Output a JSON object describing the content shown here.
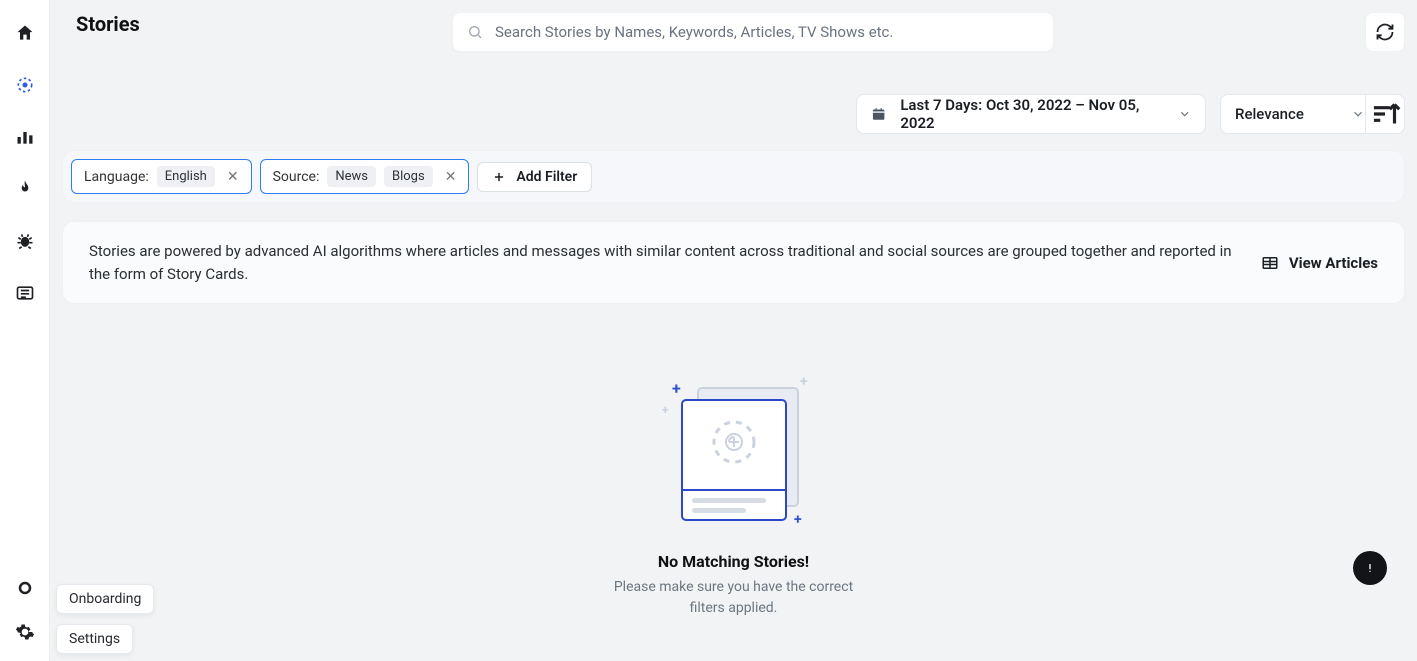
{
  "header": {
    "title": "Stories",
    "search_placeholder": "Search Stories by Names, Keywords, Articles, TV Shows etc."
  },
  "controls": {
    "date_label": "Last 7 Days: Oct 30, 2022 – Nov 05, 2022",
    "sort_label": "Relevance"
  },
  "filters": {
    "chips": [
      {
        "label": "Language:",
        "tags": [
          "English"
        ]
      },
      {
        "label": "Source:",
        "tags": [
          "News",
          "Blogs"
        ]
      }
    ],
    "add_label": "Add Filter"
  },
  "info": {
    "description": "Stories are powered by advanced AI algorithms where articles and messages with similar content across traditional and social sources are grouped together and reported in the form of Story Cards.",
    "view_articles_label": "View Articles"
  },
  "empty": {
    "title": "No Matching Stories!",
    "subtitle_line1": "Please make sure you have the correct",
    "subtitle_line2": "filters applied."
  },
  "sidebar": {
    "tooltips": {
      "onboarding": "Onboarding",
      "settings": "Settings"
    }
  },
  "icons": {
    "home": "home-icon",
    "target": "target-icon",
    "analytics": "analytics-icon",
    "trending": "trending-icon",
    "bug": "bug-icon",
    "news": "news-icon",
    "onboarding": "onboarding-icon",
    "settings": "settings-icon",
    "search": "search-icon",
    "refresh": "refresh-icon",
    "calendar": "calendar-icon",
    "chevron_down": "chevron-down-icon",
    "sort": "sort-icon",
    "plus": "plus-icon",
    "table": "table-icon",
    "alert": "alert-icon"
  }
}
